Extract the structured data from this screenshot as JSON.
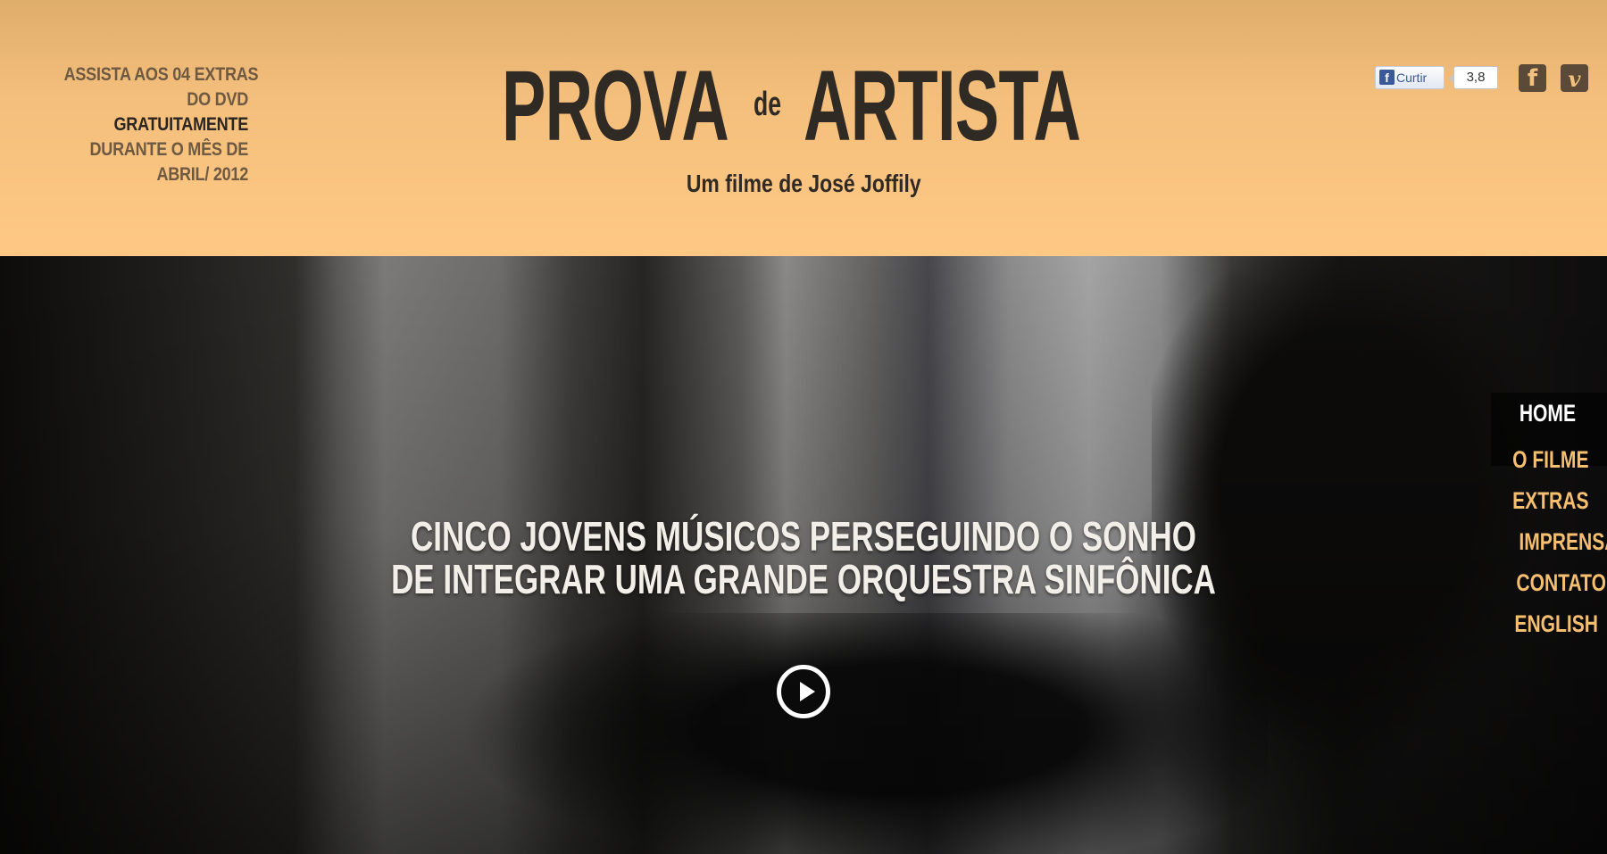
{
  "promo": {
    "lines": [
      {
        "text": "ASSISTA AOS 04 EXTRAS",
        "emphasis": false
      },
      {
        "text": "DO DVD",
        "emphasis": false
      },
      {
        "text": "GRATUITAMENTE",
        "emphasis": true
      },
      {
        "text": "DURANTE O MÊS DE",
        "emphasis": false
      },
      {
        "text": "ABRIL/ 2012",
        "emphasis": false
      }
    ]
  },
  "logo": {
    "word1": "PROVA",
    "connector": "de",
    "word2": "ARTISTA",
    "subtitle": "Um filme de José Joffily"
  },
  "social": {
    "like_label": "Curtir",
    "like_count": "3,8",
    "facebook_icon": "facebook-icon",
    "vimeo_icon": "vimeo-icon"
  },
  "hero": {
    "tagline_line1": "CINCO JOVENS MÚSICOS PERSEGUINDO O SONHO",
    "tagline_line2": "DE INTEGRAR UMA GRANDE ORQUESTRA SINFÔNICA",
    "play_icon": "play-icon"
  },
  "nav": {
    "items": [
      "HOME",
      "O FILME",
      "EXTRAS",
      "IMPRENSA",
      "CONTATO",
      "ENGLISH"
    ],
    "active": "HOME"
  },
  "colors": {
    "header_bg": "#ffc985",
    "nav_link": "#f6be6f",
    "logo_text": "#302a25"
  }
}
